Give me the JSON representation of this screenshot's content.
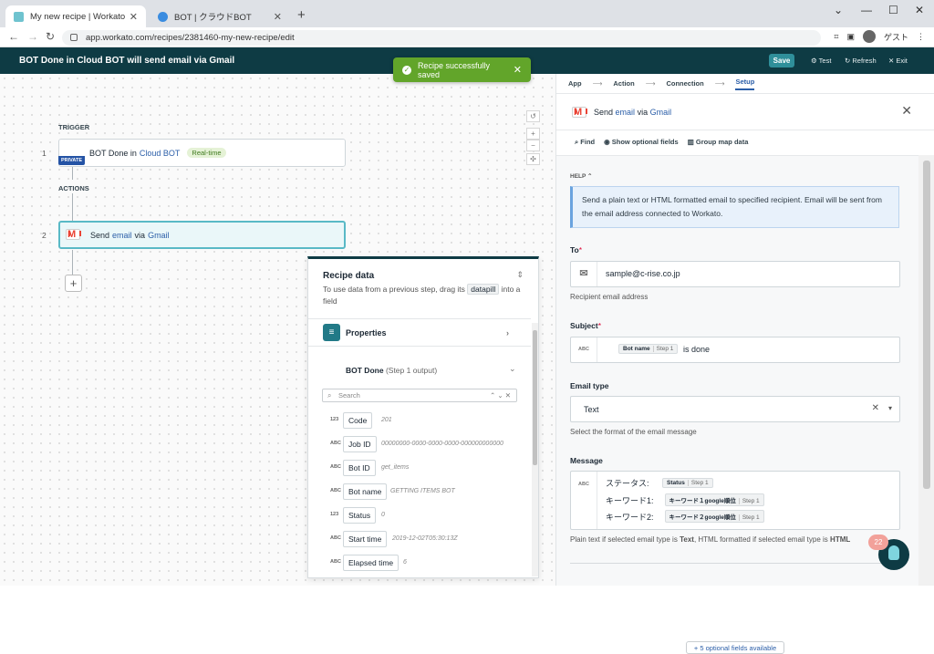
{
  "browser": {
    "tab1": "My new recipe | Workato",
    "tab2": "BOT | クラウドBOT",
    "url": "app.workato.com/recipes/2381460-my-new-recipe/edit",
    "guest": "ゲスト"
  },
  "header": {
    "title": "BOT Done in Cloud BOT will send email via Gmail",
    "save": "Save",
    "test": "Test",
    "refresh": "Refresh",
    "exit": "Exit"
  },
  "toast": {
    "text": "Recipe successfully saved"
  },
  "canvas": {
    "trigger_label": "TRIGGER",
    "actions_label": "ACTIONS",
    "private": "PRIVATE",
    "step1": {
      "num": "1",
      "pre": "BOT Done in",
      "app": "Cloud BOT",
      "badge": "Real-time"
    },
    "step2": {
      "num": "2",
      "pre": "Send",
      "mid": "email",
      "via": "via",
      "app": "Gmail"
    }
  },
  "recipe_data": {
    "title": "Recipe data",
    "sub_pre": "To use data from a previous step, drag its",
    "pill": "datapill",
    "sub_post": "into a field",
    "properties": "Properties",
    "output_title": "BOT Done",
    "output_sub": "(Step 1 output)",
    "search_placeholder": "Search",
    "fields": [
      {
        "type": "123",
        "name": "Code",
        "value": "201"
      },
      {
        "type": "ABC",
        "name": "Job ID",
        "value": "00000000-0000-0000-0000-000000000000"
      },
      {
        "type": "ABC",
        "name": "Bot ID",
        "value": "get_items"
      },
      {
        "type": "ABC",
        "name": "Bot name",
        "value": "GETTING ITEMS BOT"
      },
      {
        "type": "123",
        "name": "Status",
        "value": "0"
      },
      {
        "type": "ABC",
        "name": "Start time",
        "value": "2019-12-02T05:30:13Z"
      },
      {
        "type": "ABC",
        "name": "Elapsed time",
        "value": "6"
      }
    ]
  },
  "panel": {
    "crumbs": [
      "App",
      "Action",
      "Connection",
      "Setup"
    ],
    "title_pre": "Send",
    "title_mid": "email",
    "title_via": "via",
    "title_app": "Gmail",
    "find": "Find",
    "show_optional": "Show optional fields",
    "group_map": "Group map data",
    "help": "HELP",
    "help_text": "Send a plain text or HTML formatted email to specified recipient. Email will be sent from the email address connected to Workato.",
    "to_label": "To",
    "to_value": "sample@c-rise.co.jp",
    "to_hint": "Recipient email address",
    "subject_label": "Subject",
    "subject_pill": "Bot name",
    "subject_step": "Step 1",
    "subject_text": "is done",
    "email_type_label": "Email type",
    "email_type_value": "Text",
    "email_type_hint": "Select the format of the email message",
    "message_label": "Message",
    "msg_lines": [
      {
        "text": "ステータス:",
        "pill": "Status",
        "step": "Step 1"
      },
      {
        "text": "キーワード1:",
        "pill": "キーワード１google順位",
        "step": "Step 1"
      },
      {
        "text": "キーワード2:",
        "pill": "キーワード２google順位",
        "step": "Step 1"
      }
    ],
    "message_hint_pre": "Plain text if selected email type is",
    "message_hint_t": "Text",
    "message_hint_mid": ", HTML formatted if selected email type is",
    "message_hint_h": "HTML",
    "optional_button": "+ 5 optional fields available",
    "abc": "ABC"
  },
  "bubble": {
    "count": "22"
  }
}
